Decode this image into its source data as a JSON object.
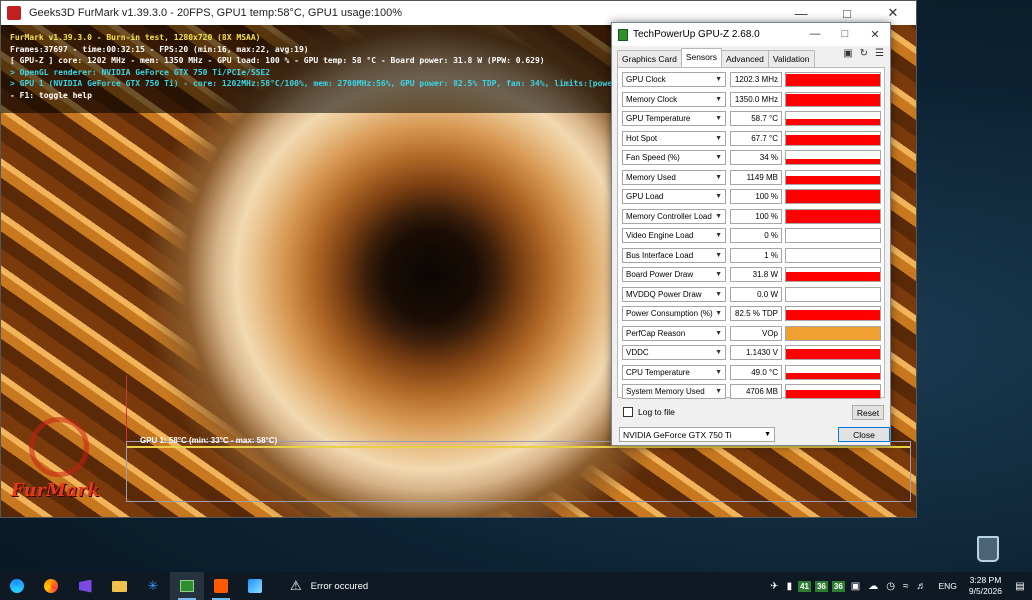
{
  "furmark": {
    "window_title": "Geeks3D FurMark v1.39.3.0 - 20FPS, GPU1 temp:58°C, GPU1 usage:100%",
    "info_lines": [
      {
        "text": "FurMark v1.39.3.0 - Burn-in test, 1280x720 (8X MSAA)",
        "color": "yellow"
      },
      {
        "text": "Frames:37697 - time:00:32:15 - FPS:20 (min:16, max:22, avg:19)",
        "color": "white"
      },
      {
        "text": "[ GPU-Z ] core: 1202 MHz - mem: 1350 MHz - GPU load: 100 % - GPU temp: 58 °C - Board power: 31.8 W (PPW: 0.629)",
        "color": "white"
      },
      {
        "text": "> OpenGL renderer: NVIDIA GeForce GTX 750 Ti/PCIe/SSE2",
        "color": "cyan"
      },
      {
        "text": "> GPU 1 (NVIDIA GeForce GTX 750 Ti) - core: 1202MHz:58°C/100%, mem: 2700MHz:56%, GPU power: 82.5% TDP, fan: 34%, limits:[power:0, temp:0, volt:0, OV:1]",
        "color": "cyan"
      },
      {
        "text": "- F1: toggle help",
        "color": "white"
      }
    ],
    "graph_label": "GPU 1: 58°C (min: 33°C - max: 58°C)",
    "logo_text": "FurMark"
  },
  "gpuz": {
    "window_title": "TechPowerUp GPU-Z 2.68.0",
    "tabs": [
      "Graphics Card",
      "Sensors",
      "Advanced",
      "Validation"
    ],
    "active_tab": "Sensors",
    "sensors": [
      {
        "name": "GPU Clock",
        "value": "1202.3 MHz",
        "level": 0.95,
        "color": "#ff0000"
      },
      {
        "name": "Memory Clock",
        "value": "1350.0 MHz",
        "level": 0.85,
        "color": "#ff0000"
      },
      {
        "name": "GPU Temperature",
        "value": "58.7 °C",
        "level": 0.45,
        "color": "#ff0000"
      },
      {
        "name": "Hot Spot",
        "value": "67.7 °C",
        "level": 0.75,
        "color": "#ff0000"
      },
      {
        "name": "Fan Speed (%)",
        "value": "34 %",
        "level": 0.35,
        "color": "#ff0000"
      },
      {
        "name": "Memory Used",
        "value": "1149 MB",
        "level": 0.6,
        "color": "#ff0000"
      },
      {
        "name": "GPU Load",
        "value": "100 %",
        "level": 1.0,
        "color": "#ff0000"
      },
      {
        "name": "Memory Controller Load",
        "value": "100 %",
        "level": 1.0,
        "color": "#ff0000"
      },
      {
        "name": "Video Engine Load",
        "value": "0 %",
        "level": 0,
        "color": "#ff0000"
      },
      {
        "name": "Bus Interface Load",
        "value": "1 %",
        "level": 0,
        "color": "#ff0000"
      },
      {
        "name": "Board Power Draw",
        "value": "31.8 W",
        "level": 0.7,
        "color": "#ff0000"
      },
      {
        "name": "MVDDQ Power Draw",
        "value": "0.0 W",
        "level": 0,
        "color": "#ff0000"
      },
      {
        "name": "Power Consumption (%)",
        "value": "82.5 % TDP",
        "level": 0.8,
        "color": "#ff0000"
      },
      {
        "name": "PerfCap Reason",
        "value": "VOp",
        "level": 1.0,
        "color": "#f0a030"
      },
      {
        "name": "VDDC",
        "value": "1.1430 V",
        "level": 0.75,
        "color": "#ff0000"
      },
      {
        "name": "CPU Temperature",
        "value": "49.0 °C",
        "level": 0.45,
        "color": "#ff0000"
      },
      {
        "name": "System Memory Used",
        "value": "4706 MB",
        "level": 0.6,
        "color": "#ff0000"
      }
    ],
    "log_to_file_label": "Log to file",
    "reset_label": "Reset",
    "gpu_select_value": "NVIDIA GeForce GTX 750 Ti",
    "close_label": "Close"
  },
  "taskbar": {
    "warning_text": "Error occured",
    "tray_badges": [
      "41",
      "36",
      "36"
    ],
    "language": "ENG",
    "time": "3:28 PM",
    "date": "9/5/2026"
  }
}
